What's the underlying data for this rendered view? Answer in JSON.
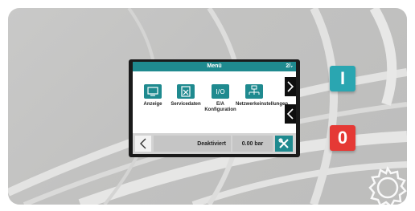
{
  "screen": {
    "title": "Menü",
    "page_indicator": "2/₇"
  },
  "menu_items": [
    {
      "label": "Anzeige",
      "icon": "monitor-icon"
    },
    {
      "label": "Servicedaten",
      "icon": "clipboard-tools-icon"
    },
    {
      "label": "E/A Konfiguration",
      "icon": "io-icon"
    },
    {
      "label": "Netzwerkeinstellungen",
      "icon": "network-icon"
    }
  ],
  "status_bar": {
    "status": "Deaktiviert",
    "pressure": "0.00 bar"
  },
  "hardware_buttons": {
    "on_label": "I",
    "off_label": "0"
  },
  "colors": {
    "accent": "#1f8a8f",
    "on_button": "#2aa6b1",
    "off_button": "#e53935",
    "panel": "#c4c4c3"
  }
}
